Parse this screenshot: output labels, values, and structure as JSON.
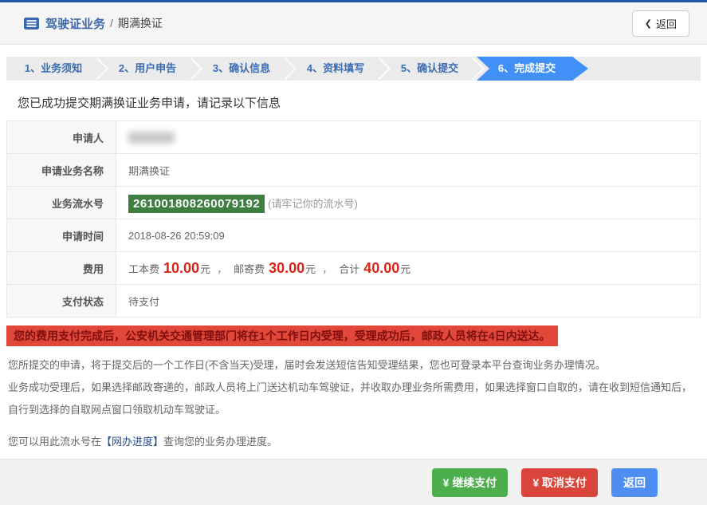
{
  "header": {
    "title": "驾驶证业务",
    "separator": "/",
    "subtitle": "期满换证",
    "back_chevron": "❮",
    "back_label": "返回"
  },
  "stepper": {
    "active_index": 5,
    "steps": [
      {
        "label": "1、业务须知"
      },
      {
        "label": "2、用户申告"
      },
      {
        "label": "3、确认信息"
      },
      {
        "label": "4、资料填写"
      },
      {
        "label": "5、确认提交"
      },
      {
        "label": "6、完成提交"
      }
    ]
  },
  "main": {
    "success_message": "您已成功提交期满换证业务申请，请记录以下信息",
    "table": {
      "rows": [
        {
          "label": "申请人",
          "value": "",
          "redacted": true
        },
        {
          "label": "申请业务名称",
          "value": "期满换证"
        },
        {
          "label": "业务流水号",
          "serial": "261001808260079192",
          "note": "(请牢记你的流水号)"
        },
        {
          "label": "申请时间",
          "value": "2018-08-26 20:59:09"
        },
        {
          "label": "费用"
        },
        {
          "label": "支付状态",
          "value": "待支付"
        }
      ],
      "fee": {
        "separator": "，",
        "parts": [
          {
            "label": "工本费",
            "amount": "10.00",
            "unit": "元"
          },
          {
            "label": "邮寄费",
            "amount": "30.00",
            "unit": "元"
          },
          {
            "label": "合计",
            "amount": "40.00",
            "unit": "元"
          }
        ]
      }
    },
    "warning_banner": "您的费用支付完成后，公安机关交通管理部门将在1个工作日内受理，受理成功后，邮政人员将在4日内送达。",
    "paragraphs": [
      "您所提交的申请，将于提交后的一个工作日(不含当天)受理，届时会发送短信告知受理结果，您也可登录本平台查询业务办理情况。",
      "业务成功受理后，如果选择邮政寄递的，邮政人员将上门送达机动车驾驶证，并收取办理业务所需费用，如果选择窗口自取的，请在收到短信通知后，自行到选择的自取网点窗口领取机动车驾驶证。"
    ],
    "progress_note": {
      "prefix": "您可以用此流水号在",
      "highlight": "【网办进度】",
      "suffix": "查询您的业务办理进度。"
    }
  },
  "footer": {
    "buttons": [
      {
        "currency": "¥",
        "label": "继续支付"
      },
      {
        "currency": "¥",
        "label": "取消支付"
      },
      {
        "label": "返回"
      }
    ]
  },
  "colors": {
    "top_line": "#1e55a5",
    "active_step": "#4190f7",
    "serial_badge_bg": "#3e7e41",
    "fee_amount": "#dd2418",
    "warning_bg": "#e2483a",
    "warning_text": "#7e0f0f",
    "btn_continue": "#4cae4c",
    "btn_cancel": "#d9453b",
    "btn_return": "#4e8df2"
  }
}
